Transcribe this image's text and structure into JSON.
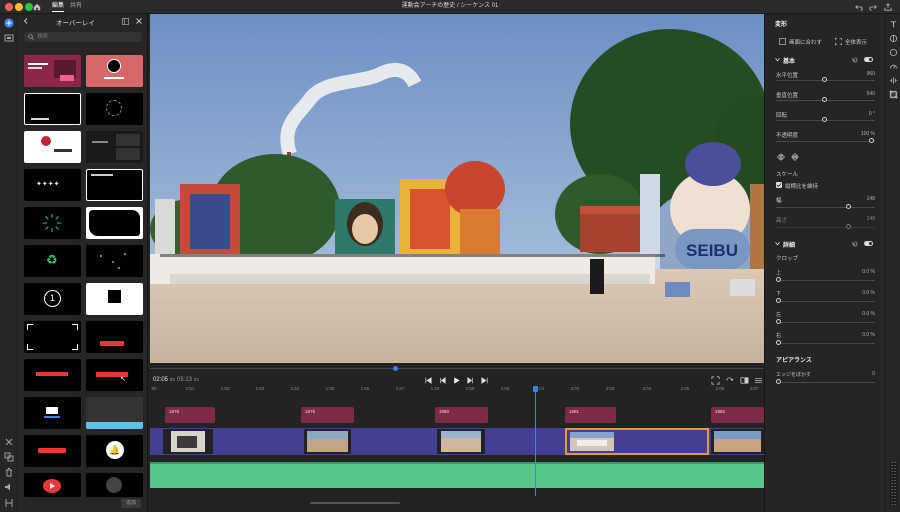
{
  "titlebar": {
    "tab_edit": "編集",
    "tab_share": "共有",
    "document_title": "運動会アーチの歴史 / シーケンス 01"
  },
  "overlay_panel": {
    "title": "オーバーレイ",
    "search_placeholder": "検索",
    "add_label": "追加",
    "thumbs": [
      {
        "tag": "lower-third"
      },
      {
        "tag": "circle-frame"
      },
      {
        "tag": "letterbox"
      },
      {
        "tag": "crosshair"
      },
      {
        "tag": "red-frame"
      },
      {
        "tag": "split-screen"
      },
      {
        "tag": "title-animation"
      },
      {
        "tag": "caption"
      },
      {
        "tag": "light-burst"
      },
      {
        "tag": "brush-frame"
      },
      {
        "tag": "recycle"
      },
      {
        "tag": "particles"
      },
      {
        "tag": "countdown"
      },
      {
        "tag": "polaroid"
      },
      {
        "tag": "viewfinder"
      },
      {
        "tag": "subscribe-small"
      },
      {
        "tag": "subscribe-bar"
      },
      {
        "tag": "subscribe-button"
      },
      {
        "tag": "tooltip"
      },
      {
        "tag": "subscribe-strip"
      },
      {
        "tag": "subscribe-text"
      },
      {
        "tag": "bell"
      },
      {
        "tag": "youtube-logo"
      },
      {
        "tag": "social"
      }
    ]
  },
  "preview_scene": {
    "banner_text": "SEIBU"
  },
  "transport": {
    "timecode_current": "02:05",
    "timecode_current_frames": "03",
    "timecode_total": "05:13",
    "timecode_total_frames": "03",
    "progress": 0.4
  },
  "timeline": {
    "ruler_ticks": [
      "50",
      "1:51",
      "1:52",
      "1:53",
      "1:54",
      "1:55",
      "1:56",
      "1:57",
      "1:58",
      "1:59",
      "2:00",
      "2:01",
      "2:02",
      "2:03",
      "2:04",
      "2:05",
      "2:06",
      "2:07"
    ],
    "title_clips": [
      {
        "label": "1978"
      },
      {
        "label": "1979"
      },
      {
        "label": "1980"
      },
      {
        "label": "1981"
      },
      {
        "label": "1982"
      }
    ]
  },
  "properties": {
    "section_title": "変形",
    "fit_button": "画面に合わす",
    "fill_button": "全体表示",
    "basic_header": "基本",
    "position_x_label": "水平位置",
    "position_x_value": "960",
    "position_y_label": "垂直位置",
    "position_y_value": "540",
    "rotation_label": "回転",
    "rotation_value": "0 °",
    "opacity_label": "不透明度",
    "opacity_value": "100 %",
    "scale_label": "スケール",
    "keep_ratio_label": "縦横比を維持",
    "width_label": "幅",
    "width_value": "148",
    "height_label": "高さ",
    "height_value": "148",
    "detail_header": "詳細",
    "crop_label": "クロップ",
    "crop_top_label": "上",
    "crop_top_value": "0.0 %",
    "crop_bottom_label": "下",
    "crop_bottom_value": "0.0 %",
    "crop_left_label": "左",
    "crop_left_value": "0.0 %",
    "crop_right_label": "右",
    "crop_right_value": "0.0 %",
    "appearance_header": "アピアランス",
    "feather_label": "エッジをぼかす",
    "feather_value": "0"
  },
  "colors": {
    "accent": "#3b82f6",
    "title_clip": "#7d2a48",
    "video_track": "#434093",
    "audio_track": "#55c589",
    "selected_clip": "#e09a3a"
  }
}
